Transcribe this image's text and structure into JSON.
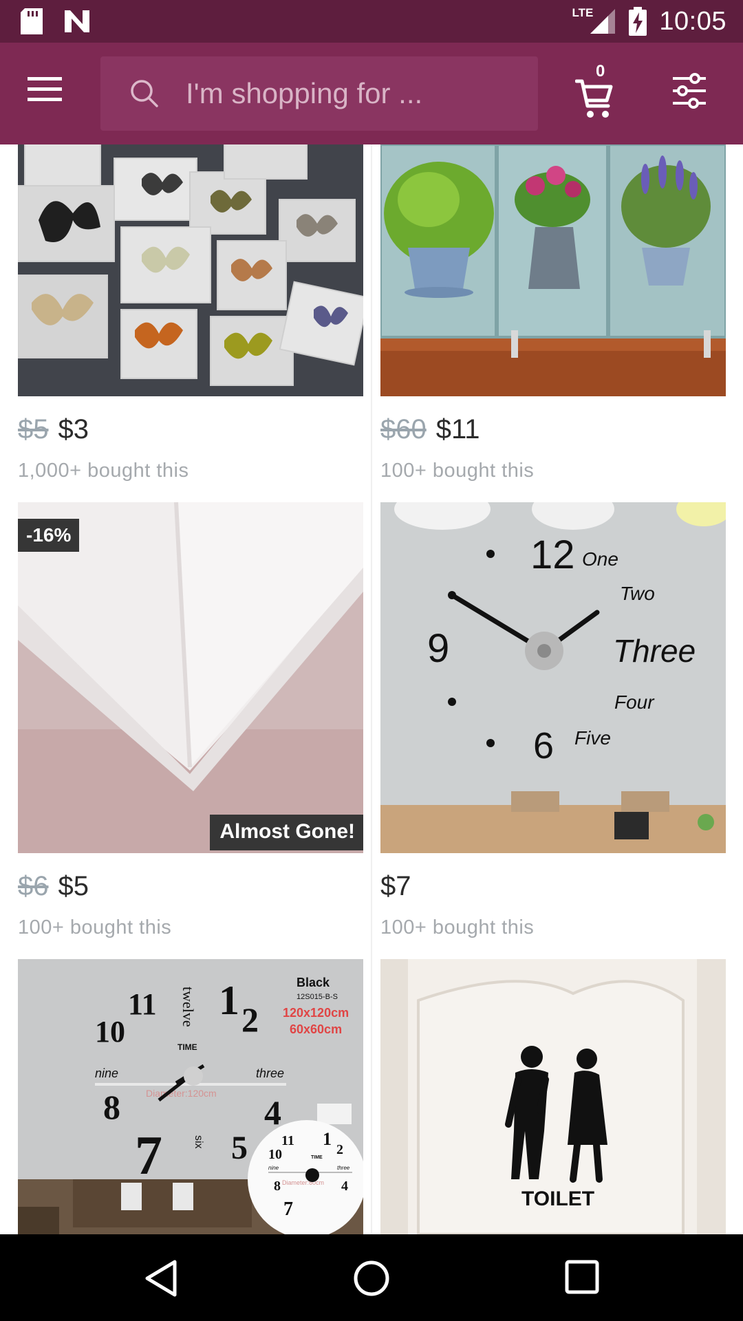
{
  "status_bar": {
    "network": "LTE",
    "time": "10:05"
  },
  "app_bar": {
    "search_placeholder": "I'm shopping for ...",
    "cart_count": "0",
    "colors": {
      "status": "#5e1e3e",
      "bar": "#7e2953",
      "search": "#8a3561"
    }
  },
  "products": [
    {
      "old_price": "$5",
      "price": "$3",
      "bought": "1,000+ bought this",
      "image": "butterfly wall stickers"
    },
    {
      "old_price": "$60",
      "price": "$11",
      "bought": "100+ bought this",
      "image": "potted plant cabinet decals"
    },
    {
      "old_price": "$6",
      "price": "$5",
      "bought": "100+ bought this",
      "badge": "-16%",
      "label": "Almost Gone!",
      "image": "white corner guard strip"
    },
    {
      "old_price": "",
      "price": "$7",
      "bought": "100+ bought this",
      "image": "DIY wall clock",
      "clock_text": {
        "twelve": "12",
        "nine": "9",
        "six": "6",
        "words": [
          "One",
          "Two",
          "Three",
          "Four",
          "Five"
        ]
      }
    },
    {
      "image": "large mirror wall clock",
      "clock_text": {
        "eleven": "11",
        "ten": "10",
        "one": "1",
        "two": "2",
        "eight": "8",
        "four": "4",
        "seven": "7",
        "five": "5",
        "twelve_word": "twelve",
        "time_word": "TIME",
        "nine_word": "nine",
        "three_word": "three",
        "six_word": "six",
        "color": "Black",
        "model": "12S015-B-S",
        "size1": "120x120cm",
        "size2": "60x60cm",
        "diameter": "Diameter:120cm",
        "small": {
          "eleven": "11",
          "one": "1",
          "two": "2",
          "ten": "10",
          "time_word": "TIME",
          "nine_word": "nine",
          "three_word": "three",
          "eight": "8",
          "four": "4",
          "seven": "7",
          "diameter": "Diameter:60cm"
        }
      }
    },
    {
      "image": "toilet door sign",
      "sign_text": "TOILET"
    }
  ]
}
